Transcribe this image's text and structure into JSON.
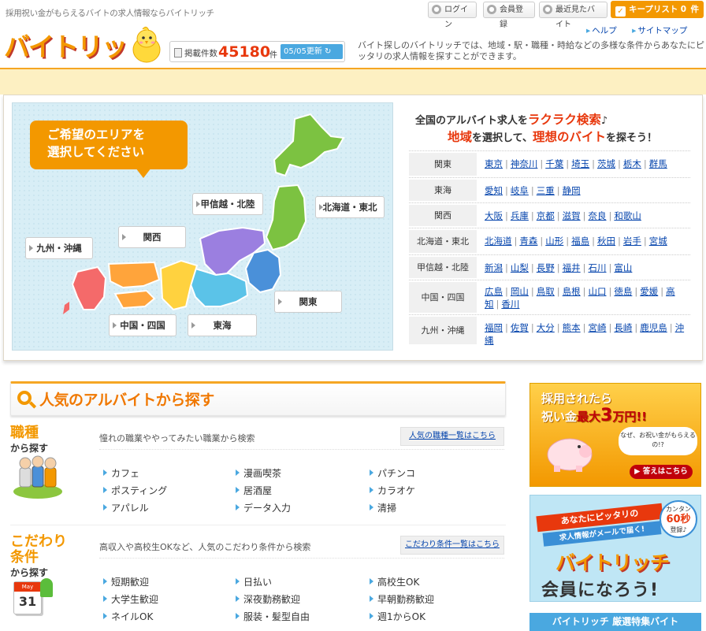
{
  "header": {
    "tagline": "採用祝い金がもらえるバイトの求人情報ならバイトリッチ",
    "top_buttons": [
      {
        "label": "ログイン",
        "icon": "lock-icon"
      },
      {
        "label": "会員登録",
        "icon": "user-icon"
      },
      {
        "label": "最近見たバイト",
        "icon": "clock-icon"
      }
    ],
    "keep_list": {
      "label": "キープリスト",
      "count": "0",
      "unit": "件"
    },
    "logo": "バイトリッチ",
    "count": {
      "label": "掲載件数",
      "value": "45180",
      "unit": "件",
      "updated": "05/05更新"
    },
    "help": "ヘルプ",
    "sitemap": "サイトマップ",
    "description": "バイト探しのバイトリッチでは、地域・駅・職種・時給などの多様な条件からあなたにピッタリの求人情報を探すことができます。"
  },
  "area": {
    "bubble": "ご希望のエリアを選択してください",
    "map_labels": {
      "koshinetsu": "甲信越・北陸",
      "hokkaido": "北海道・東北",
      "kyushu": "九州・沖縄",
      "kansai": "関西",
      "kanto": "関東",
      "chugoku": "中国・四国",
      "tokai": "東海"
    },
    "title1_pre": "全国のアルバイト求人を",
    "title1_em": "ラクラク検索",
    "title1_post": "♪",
    "title2_em1": "地域",
    "title2_mid": "を選択して、",
    "title2_em2": "理想のバイト",
    "title2_post": "を探そう！",
    "regions": [
      {
        "name": "関東",
        "prefs": [
          "東京",
          "神奈川",
          "千葉",
          "埼玉",
          "茨城",
          "栃木",
          "群馬"
        ]
      },
      {
        "name": "東海",
        "prefs": [
          "愛知",
          "岐阜",
          "三重",
          "静岡"
        ]
      },
      {
        "name": "関西",
        "prefs": [
          "大阪",
          "兵庫",
          "京都",
          "滋賀",
          "奈良",
          "和歌山"
        ]
      },
      {
        "name": "北海道・東北",
        "prefs": [
          "北海道",
          "青森",
          "山形",
          "福島",
          "秋田",
          "岩手",
          "宮城"
        ]
      },
      {
        "name": "甲信越・北陸",
        "prefs": [
          "新潟",
          "山梨",
          "長野",
          "福井",
          "石川",
          "富山"
        ]
      },
      {
        "name": "中国・四国",
        "prefs": [
          "広島",
          "岡山",
          "鳥取",
          "島根",
          "山口",
          "徳島",
          "愛媛",
          "高知",
          "香川"
        ]
      },
      {
        "name": "九州・沖縄",
        "prefs": [
          "福岡",
          "佐賀",
          "大分",
          "熊本",
          "宮崎",
          "長崎",
          "鹿児島",
          "沖縄"
        ]
      }
    ]
  },
  "popular": {
    "title": "人気のアルバイトから探す",
    "job": {
      "title": "職種",
      "subtitle": "から探す",
      "desc": "憧れの職業ややってみたい職業から検索",
      "more": "人気の職種一覧はこちら",
      "items": [
        "カフェ",
        "漫画喫茶",
        "パチンコ",
        "ポスティング",
        "居酒屋",
        "カラオケ",
        "アパレル",
        "データ入力",
        "清掃"
      ]
    },
    "cond": {
      "title1": "こだわり",
      "title2": "条件",
      "subtitle": "から探す",
      "desc": "高収入や高校生OKなど、人気のこだわり条件から検索",
      "more": "こだわり条件一覧はこちら",
      "calendar_month": "May",
      "calendar_day": "31",
      "items": [
        "短期歓迎",
        "日払い",
        "高校生OK",
        "大学生歓迎",
        "深夜勤務歓迎",
        "早朝勤務歓迎",
        "ネイルOK",
        "服装・髪型自由",
        "週1からOK"
      ]
    }
  },
  "banners": {
    "reward": {
      "line1": "採用されたら",
      "line2a": "祝い金",
      "line2b": "最大",
      "line2c": "3",
      "line2d": "万円!!",
      "bubble": "なぜ、お祝い金がもらえるの!?",
      "button": "答えはこちら"
    },
    "member": {
      "line1": "あなたにピッタリの",
      "line2": "求人情報がメールで届く!",
      "badge1": "カンタン",
      "badge2": "60秒",
      "badge3": "登録♪",
      "logo": "バイトリッチ",
      "cta": "会員になろう!"
    },
    "special": "バイトリッチ 厳選特集バイト"
  },
  "colors": {
    "accent": "#f39800",
    "link": "#0645ad",
    "emphasis": "#e8380d"
  }
}
